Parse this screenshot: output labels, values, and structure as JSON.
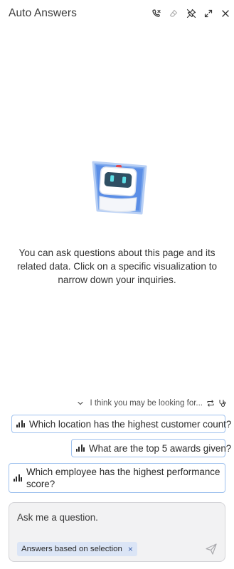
{
  "header": {
    "title": "Auto Answers",
    "icons": [
      "call-disconnect-icon",
      "eraser-icon",
      "unpin-icon",
      "expand-icon",
      "close-icon"
    ]
  },
  "hero": {
    "illustration": "robot-icon",
    "text": "You can ask questions about this page and its related data. Click on a specific visualization to narrow down your inquiries."
  },
  "suggestions": {
    "heading": "I think you may be looking for...",
    "items": [
      {
        "label": "Which location has the highest customer count?"
      },
      {
        "label": "What are the top 5 awards given?"
      },
      {
        "label": "Which employee has the highest performance score?"
      }
    ]
  },
  "composer": {
    "placeholder": "Ask me a question.",
    "chip_label": "Answers based on selection",
    "chip_remove": "×"
  },
  "colors": {
    "accent_border": "#9fc1ee",
    "chip_bg": "#dbe5f6",
    "composer_bg": "#f2f2f3"
  }
}
